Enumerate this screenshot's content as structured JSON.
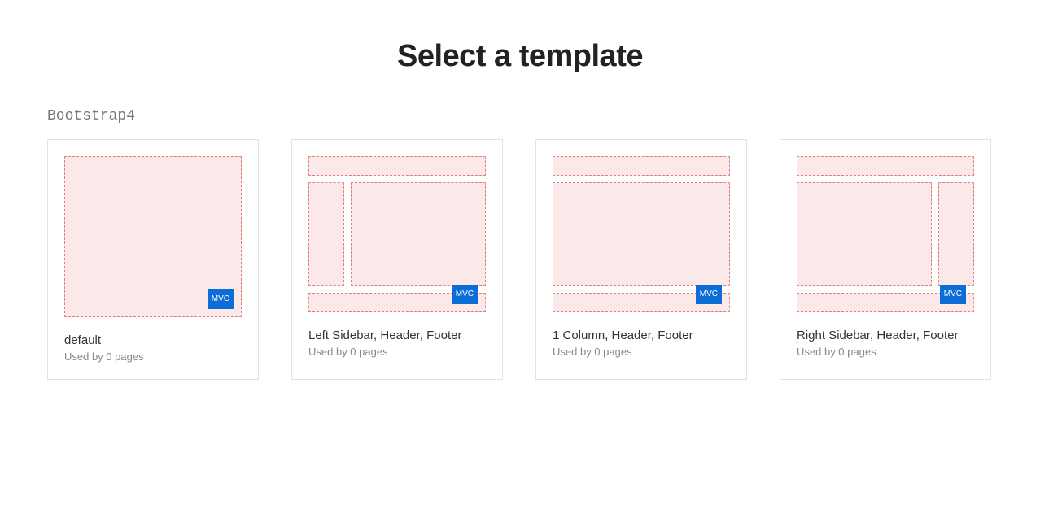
{
  "page_title": "Select a template",
  "section": {
    "label": "Bootstrap4"
  },
  "badge_text": "MVC",
  "templates": [
    {
      "id": "default",
      "title": "default",
      "subtitle": "Used by 0 pages",
      "layout": "default"
    },
    {
      "id": "left-sidebar-header-footer",
      "title": "Left Sidebar, Header, Footer",
      "subtitle": "Used by 0 pages",
      "layout": "left"
    },
    {
      "id": "one-column-header-footer",
      "title": "1 Column, Header, Footer",
      "subtitle": "Used by 0 pages",
      "layout": "1col"
    },
    {
      "id": "right-sidebar-header-footer",
      "title": "Right Sidebar, Header, Footer",
      "subtitle": "Used by 0 pages",
      "layout": "right"
    }
  ]
}
